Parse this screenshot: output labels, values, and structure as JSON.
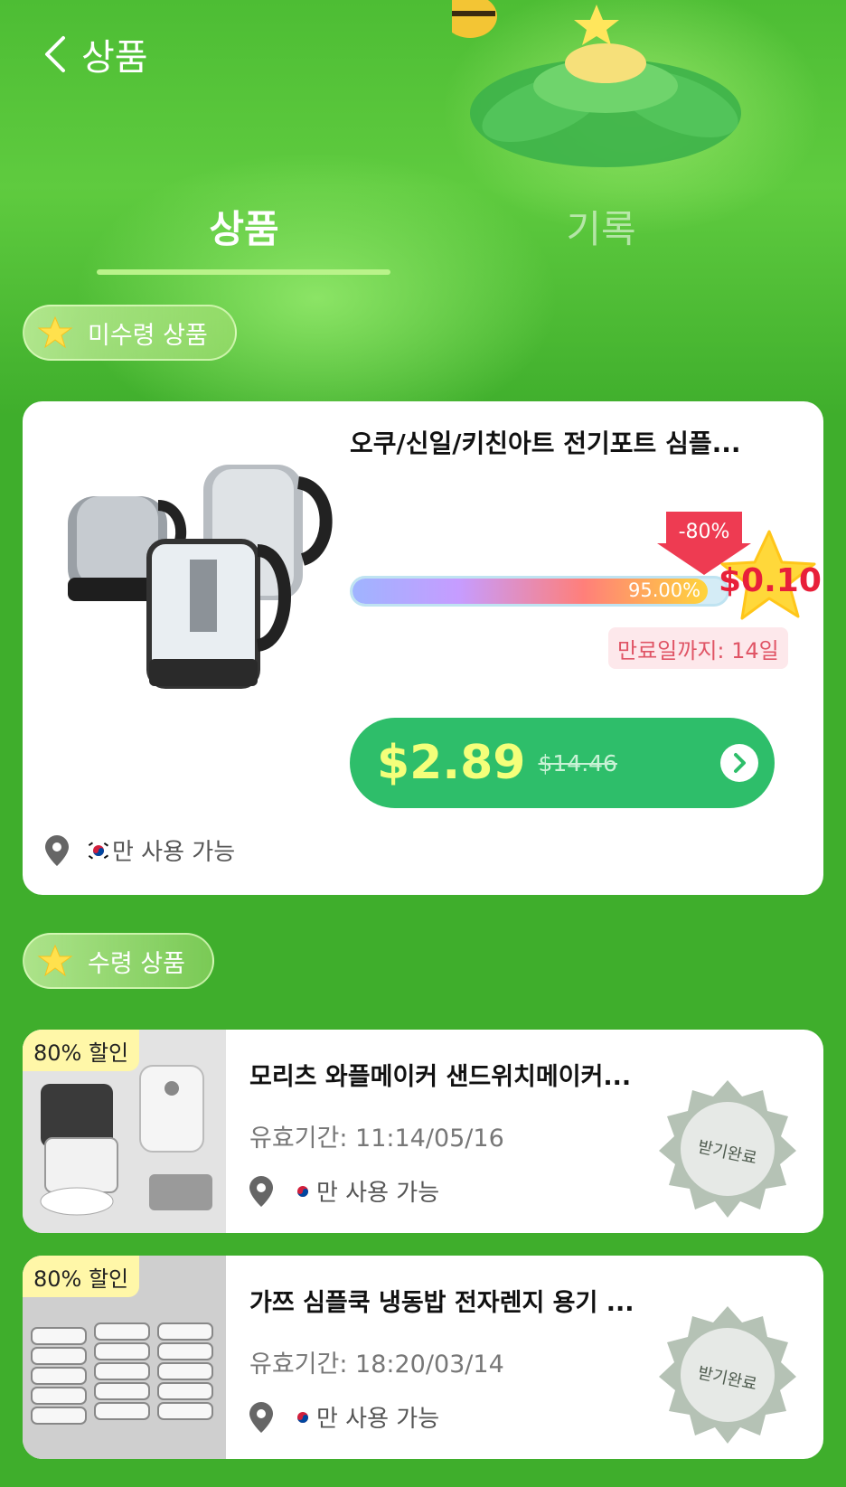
{
  "header": {
    "title": "상품"
  },
  "tabs": [
    {
      "label": "상품",
      "active": true
    },
    {
      "label": "기록",
      "active": false
    }
  ],
  "sections": {
    "unclaimed": "미수령 상품",
    "claimed": "수령 상품"
  },
  "main_product": {
    "name": "오쿠/신일/키친아트 전기포트 심플...",
    "discount": "-80%",
    "progress_text": "95.00%",
    "progress": 0.95,
    "reward_price": "$0.10",
    "expiry": "만료일까지: 14일",
    "price_now": "$2.89",
    "price_was": "$14.46",
    "location": "만 사용 가능"
  },
  "claimed_items": [
    {
      "badge": "80% 할인",
      "name": "모리츠 와플메이커 샌드위치메이커...",
      "valid": "유효기간: 11:14/05/16",
      "location": "만 사용 가능",
      "stamp": "받기완료"
    },
    {
      "badge": "80% 할인",
      "name": "가쯔 심플쿡 냉동밥 전자렌지 용기 ...",
      "valid": "유효기간: 18:20/03/14",
      "location": "만 사용 가능",
      "stamp": "받기완료"
    }
  ],
  "colors": {
    "background": "#3fae2c",
    "accent_green": "#2ebe6a",
    "price_yellow": "#f4ff7a",
    "reward_red": "#e8203a",
    "badge_yellow": "#fff7a8"
  },
  "icons": [
    "back-icon",
    "star-icon",
    "location-pin-icon",
    "korea-flag-icon",
    "chevron-right-icon",
    "received-stamp-icon"
  ]
}
